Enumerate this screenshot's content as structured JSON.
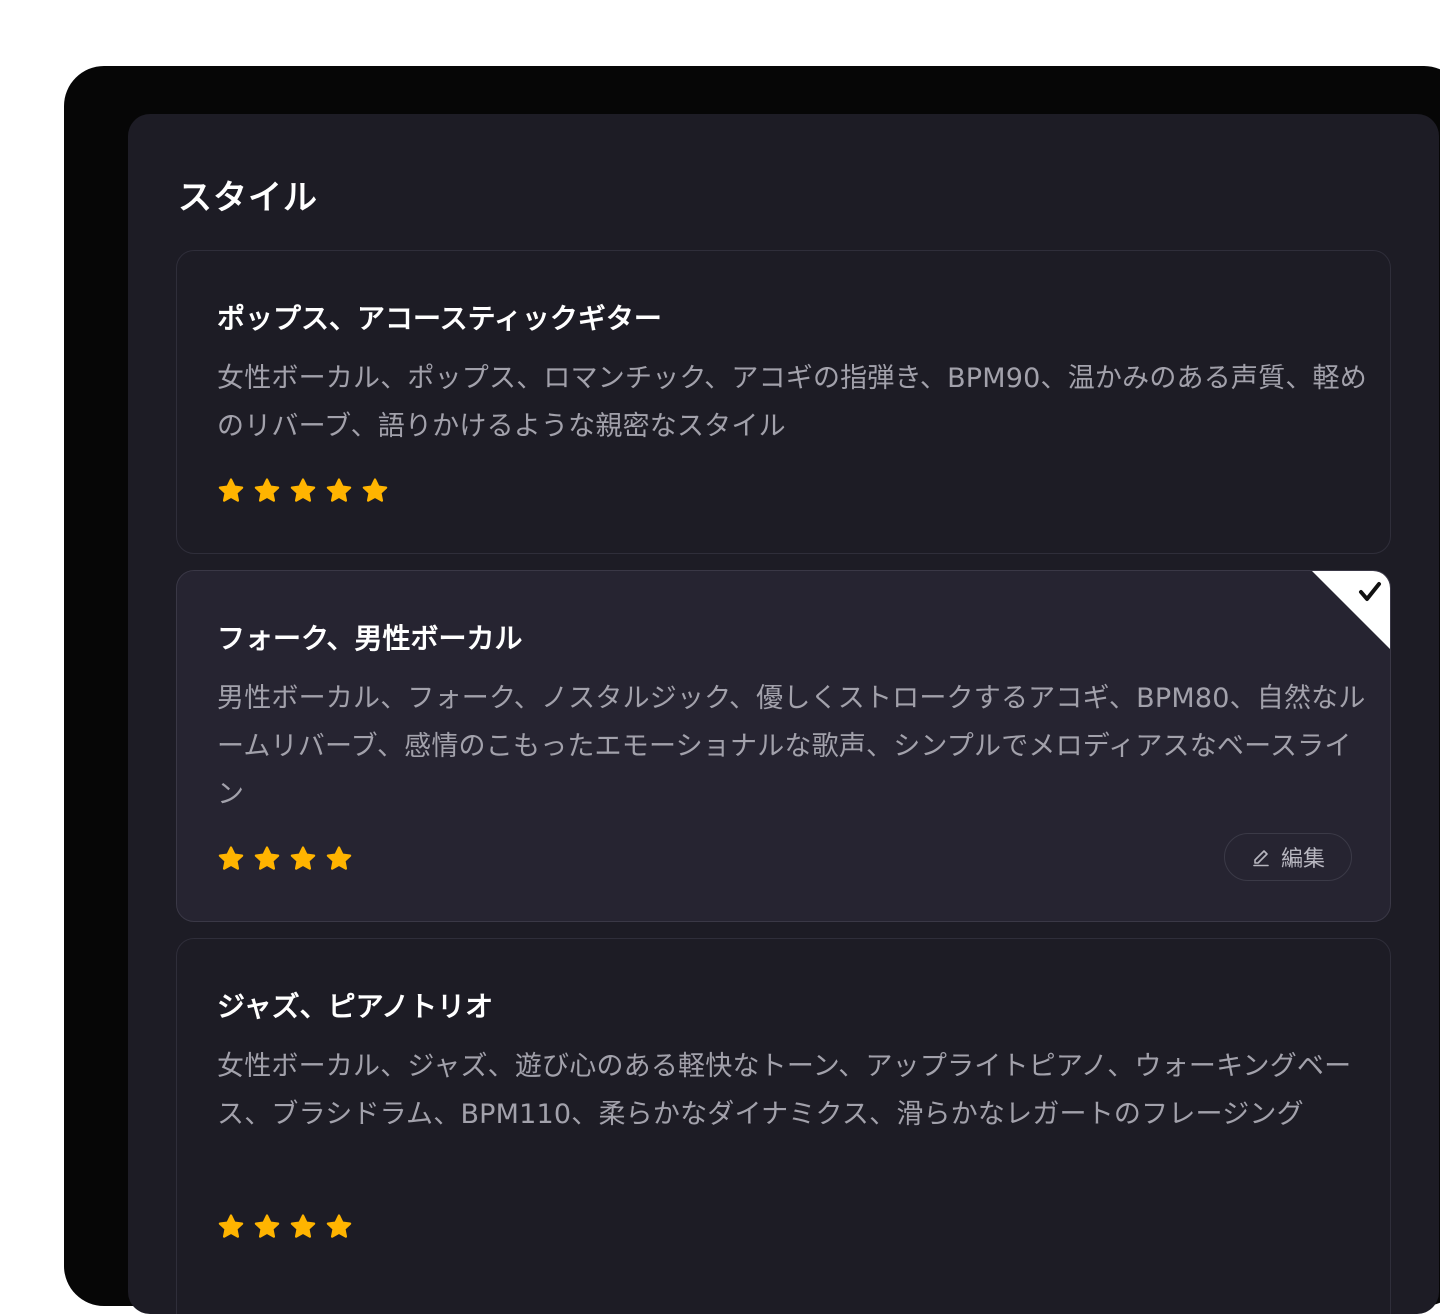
{
  "section": {
    "title": "スタイル"
  },
  "cards": [
    {
      "title": "ポップス、アコースティックギター",
      "description": "女性ボーカル、ポップス、ロマンチック、アコギの指弾き、BPM90、温かみのある声質、軽めのリバーブ、語りかけるような親密なスタイル",
      "rating": 5,
      "selected": false
    },
    {
      "title": "フォーク、男性ボーカル",
      "description": "男性ボーカル、フォーク、ノスタルジック、優しくストロークするアコギ、BPM80、自然なルームリバーブ、感情のこもったエモーショナルな歌声、シンプルでメロディアスなベースライン",
      "rating": 4,
      "selected": true,
      "edit_label": "編集"
    },
    {
      "title": "ジャズ、ピアノトリオ",
      "description": "女性ボーカル、ジャズ、遊び心のある軽快なトーン、アップライトピアノ、ウォーキングベース、ブラシドラム、BPM110、柔らかなダイナミクス、滑らかなレガートのフレージング",
      "rating": 4,
      "selected": false
    }
  ],
  "icons": {
    "star": "star-icon",
    "check": "check-icon",
    "edit": "pencil-icon"
  },
  "colors": {
    "star": "#ffb400",
    "panel": "#1d1c25",
    "selected_card": "#262431"
  }
}
